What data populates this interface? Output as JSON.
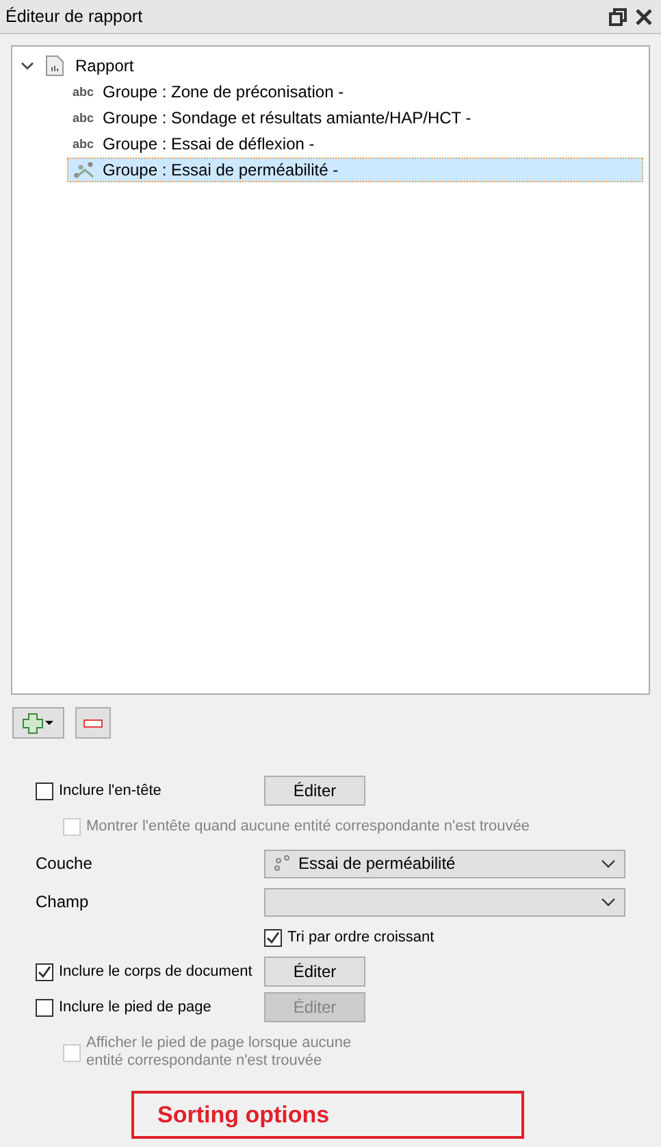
{
  "window": {
    "title": "Éditeur de rapport"
  },
  "tree": {
    "label": "Rapport",
    "expanded": true,
    "children": [
      {
        "label": "Groupe : Zone de préconisation -",
        "kind": "text",
        "glyph": "abc",
        "selected": false
      },
      {
        "label": "Groupe : Sondage et résultats amiante/HAP/HCT -",
        "kind": "text",
        "glyph": "abc",
        "selected": false
      },
      {
        "label": "Groupe : Essai de déflexion -",
        "kind": "text",
        "glyph": "abc",
        "selected": false
      },
      {
        "label": "Groupe : Essai de perméabilité -",
        "kind": "layer",
        "selected": true
      }
    ]
  },
  "options": [
    {
      "kind": "check",
      "label": "Inclure l'en-tête",
      "checked": false,
      "disabled": false,
      "button": {
        "label": "Éditer",
        "disabled": false
      }
    },
    {
      "kind": "subcheck",
      "label": "Montrer l'entête quand aucune entité correspondante n'est trouvée",
      "checked": false,
      "disabled": true
    },
    {
      "kind": "select",
      "label": "Couche",
      "value": "Essai de perméabilité"
    },
    {
      "kind": "select",
      "label": "Champ"
    },
    {
      "kind": "indentcheck",
      "label": "Tri par ordre croissant",
      "checked": true,
      "disabled": false
    },
    {
      "kind": "check",
      "label": "Inclure le corps de document",
      "checked": true,
      "disabled": false,
      "button": {
        "label": "Éditer",
        "disabled": false
      }
    },
    {
      "kind": "check",
      "label": "Inclure le pied de page",
      "checked": false,
      "disabled": false,
      "button": {
        "label": "Éditer",
        "disabled": true
      }
    },
    {
      "kind": "subcheck",
      "label": "Afficher le pied de page lorsque aucune\nentité correspondante n'est trouvée",
      "checked": false,
      "disabled": true
    }
  ],
  "annotation": {
    "label": "Sorting options"
  }
}
